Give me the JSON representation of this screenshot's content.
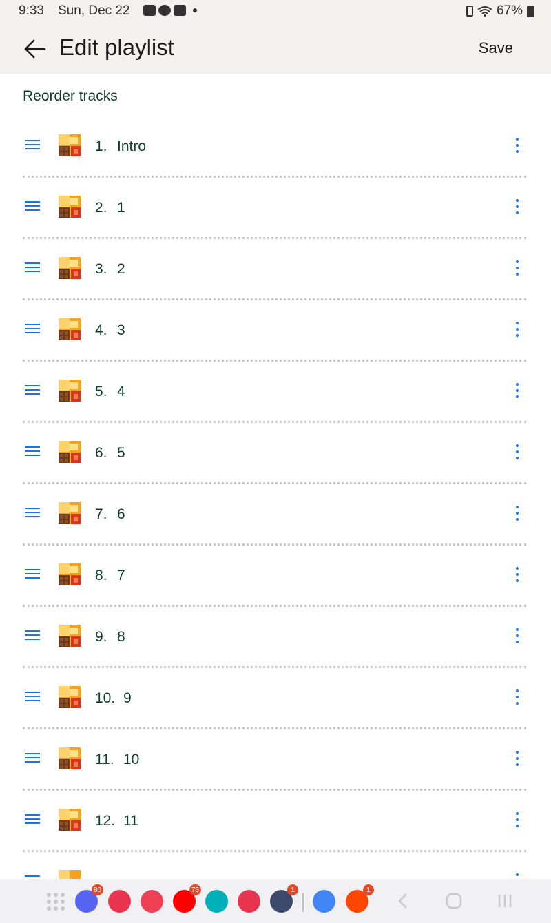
{
  "status_bar": {
    "time": "9:33",
    "date": "Sun, Dec 22",
    "battery": "67%"
  },
  "header": {
    "title": "Edit playlist",
    "save_label": "Save"
  },
  "section": {
    "title": "Reorder tracks"
  },
  "tracks": [
    {
      "number": "1.",
      "name": "Intro"
    },
    {
      "number": "2.",
      "name": "1"
    },
    {
      "number": "3.",
      "name": "2"
    },
    {
      "number": "4.",
      "name": "3"
    },
    {
      "number": "5.",
      "name": "4"
    },
    {
      "number": "6.",
      "name": "5"
    },
    {
      "number": "7.",
      "name": "6"
    },
    {
      "number": "8.",
      "name": "7"
    },
    {
      "number": "9.",
      "name": "8"
    },
    {
      "number": "10.",
      "name": "9"
    },
    {
      "number": "11.",
      "name": "10"
    },
    {
      "number": "12.",
      "name": "11"
    }
  ],
  "dock": {
    "apps": [
      {
        "icon": "discord-icon",
        "badge": "80",
        "color": "#5865f2"
      },
      {
        "icon": "app-icon",
        "badge": "",
        "color": "#e8344f"
      },
      {
        "icon": "pocket-icon",
        "badge": "",
        "color": "#ef4056"
      },
      {
        "icon": "youtube-icon",
        "badge": "73",
        "color": "#ff0000"
      },
      {
        "icon": "fitbit-icon",
        "badge": "",
        "color": "#00b0b9"
      },
      {
        "icon": "camera-app-icon",
        "badge": "",
        "color": "#e8344f"
      },
      {
        "icon": "settings-icon",
        "badge": "1",
        "color": "#3c4a6b"
      },
      {
        "icon": "docs-icon",
        "badge": "",
        "color": "#4285f4"
      },
      {
        "icon": "reddit-icon",
        "badge": "1",
        "color": "#ff4500"
      }
    ]
  },
  "colors": {
    "accent": "#1a73e8",
    "text_green": "#0f3d2a",
    "header_bg": "#f3f1ee"
  }
}
